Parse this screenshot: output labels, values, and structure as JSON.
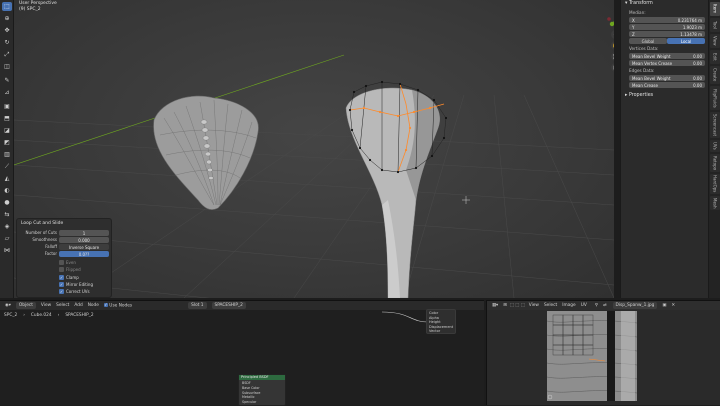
{
  "viewport": {
    "view_name": "User Perspective",
    "object_label": "(9) SPC_2"
  },
  "toolbar": {
    "tools": [
      "select-icon",
      "cursor-icon",
      "move-icon",
      "rotate-icon",
      "scale-icon",
      "transform-icon",
      "annotate-icon",
      "measure-icon",
      "add-cube-icon",
      "extrude-icon",
      "inset-icon",
      "bevel-icon",
      "loop-cut-icon",
      "knife-icon",
      "poly-build-icon",
      "spin-icon",
      "smooth-icon",
      "edge-slide-icon",
      "shrink-icon",
      "shear-icon",
      "rip-icon"
    ]
  },
  "npanel": {
    "transform_header": "Transform",
    "median_label": "Median:",
    "x_label": "X",
    "x_value": "0.231764 m",
    "y_label": "Y",
    "y_value": "1.9023 m",
    "z_label": "Z",
    "z_value": "1.13478 m",
    "global_label": "Global",
    "local_label": "Local",
    "vertices_data_label": "Vertices Data:",
    "vert_bevel_label": "Mean Bevel Weight",
    "vert_bevel_value": "0.00",
    "vert_crease_label": "Mean Vertex Crease",
    "vert_crease_value": "0.00",
    "edges_data_label": "Edges Data:",
    "edge_bevel_label": "Mean Bevel Weight",
    "edge_bevel_value": "0.00",
    "edge_crease_label": "Mean Crease",
    "edge_crease_value": "0.00",
    "properties_header": "Properties"
  },
  "ntabs": [
    "Item",
    "Tool",
    "View",
    "Edit",
    "Create",
    "FlipFluids",
    "Screencast",
    "UVs",
    "Retopo",
    "HardOps",
    "Mesh"
  ],
  "redo_panel": {
    "title": "Loop Cut and Slide",
    "cuts_label": "Number of Cuts",
    "cuts_value": "1",
    "smooth_label": "Smoothness",
    "smooth_value": "0.000",
    "falloff_label": "Falloff",
    "falloff_value": "Inverse Square",
    "factor_label": "Factor",
    "factor_value": "0.0??",
    "even_label": "Even",
    "flipped_label": "Flipped",
    "clamp_label": "Clamp",
    "mirror_label": "Mirror Editing",
    "correct_uvs_label": "Correct UVs"
  },
  "node_editor": {
    "header": {
      "object_mode": "Object",
      "view": "View",
      "select": "Select",
      "add": "Add",
      "node": "Node",
      "use_nodes": "Use Nodes",
      "slot": "Slot 1",
      "material": "SPACESHIP_2"
    },
    "breadcrumb": {
      "object": "SPC_2",
      "mesh": "Cube.024",
      "material": "SPACESHIP_2"
    },
    "popup_items": [
      "Color",
      "Alpha",
      "Height",
      "Displacement",
      "Vector"
    ],
    "node_title": "Principled BSDF",
    "node_rows": [
      "BSDF",
      "Base Color",
      "Subsurface",
      "Metallic",
      "Specular"
    ]
  },
  "image_editor": {
    "header": {
      "view": "View",
      "select": "Select",
      "image": "Image",
      "uv": "UV",
      "image_name": "Disp_Spanw_1.jpg"
    }
  },
  "colors": {
    "accent": "#4772b3",
    "selection": "#ff8a2a",
    "gizmo_x": "#e8384f",
    "gizmo_y": "#6ea620",
    "gizmo_z": "#3b7ce0"
  }
}
